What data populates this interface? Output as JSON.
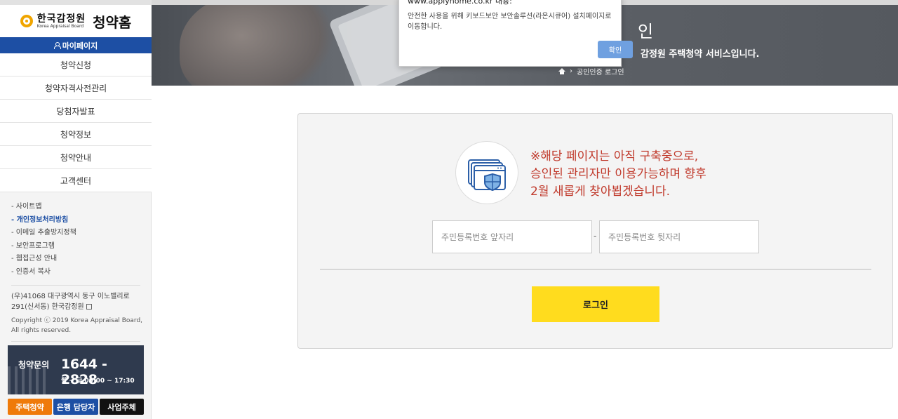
{
  "sidebar": {
    "logo": {
      "ko": "한국감정원",
      "en": "Korea Appraisal Board",
      "title": "청약홈"
    },
    "mypage_label": "마이페이지",
    "menu": [
      {
        "label": "청약신청"
      },
      {
        "label": "청약자격사전관리"
      },
      {
        "label": "당첨자발표"
      },
      {
        "label": "청약정보"
      },
      {
        "label": "청약안내"
      },
      {
        "label": "고객센터"
      }
    ],
    "links": [
      {
        "label": "- 사이트맵"
      },
      {
        "label": "- 개인정보처리방침"
      },
      {
        "label": "- 이메일 추출방지정책"
      },
      {
        "label": "- 보안프로그램"
      },
      {
        "label": "- 웹접근성 안내"
      },
      {
        "label": "- 인증서 복사"
      }
    ],
    "address_line1": "(우)41068 대구광역시 동구 이노밸리로",
    "address_line2": "291(신서동) 한국감정원",
    "copyright_line1": "Copyright ⓒ 2019 Korea Appraisal Board,",
    "copyright_line2": "All rights reserved.",
    "call": {
      "label": "청약문의",
      "number": "1644 - 2828",
      "hours": "월 ~ 금 09:00 ~ 17:30"
    },
    "tags": [
      {
        "label": "주택청약"
      },
      {
        "label": "은행 담당자"
      },
      {
        "label": "사업주체"
      }
    ]
  },
  "header": {
    "title_fragment": "인",
    "subtitle_fragment": "감정원 주택청약 서비스입니다.",
    "breadcrumb_current": "공인인증 로그인"
  },
  "dialog": {
    "title": "www.applyhome.co.kr 내용:",
    "message": "안전한 사용을 위해 키보드보안 보안솔루션(라온시큐어) 설치페이지로 이동합니다.",
    "confirm_label": "확인"
  },
  "login": {
    "notice_line1": "※해당 페이지는 아직 구축중으로,",
    "notice_line2": "승인된 관리자만 이용가능하며 향후",
    "notice_line3": "2월 새롭게 찾아뵙겠습니다.",
    "front_placeholder": "주민등록번호 앞자리",
    "separator": "-",
    "back_placeholder": "주민등록번호 뒷자리",
    "submit_label": "로그인"
  },
  "colors": {
    "brand_blue": "#1d4fa4",
    "notice_red": "#c0392b",
    "login_yellow": "#ffdc1e",
    "tag_orange": "#ef7a0a"
  }
}
